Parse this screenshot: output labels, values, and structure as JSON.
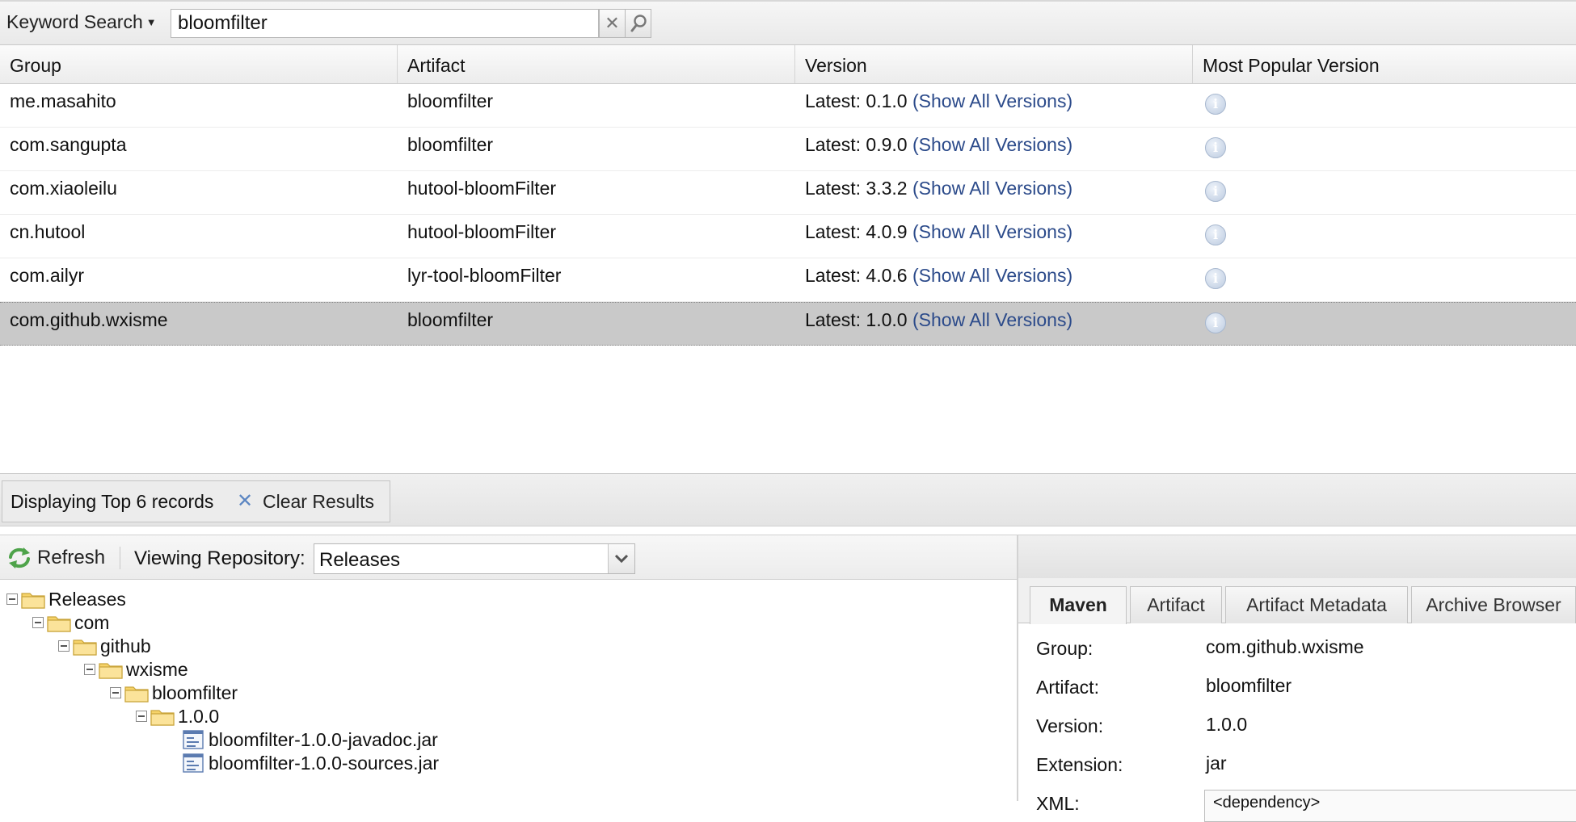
{
  "search": {
    "mode_label": "Keyword Search",
    "query": "bloomfilter"
  },
  "grid": {
    "columns": [
      "Group",
      "Artifact",
      "Version",
      "Most Popular Version"
    ],
    "rows": [
      {
        "group": "me.masahito",
        "artifact": "bloomfilter",
        "latest": "Latest: 0.1.0",
        "show_all": "(Show All Versions)"
      },
      {
        "group": "com.sangupta",
        "artifact": "bloomfilter",
        "latest": "Latest: 0.9.0",
        "show_all": "(Show All Versions)"
      },
      {
        "group": "com.xiaoleilu",
        "artifact": "hutool-bloomFilter",
        "latest": "Latest: 3.3.2",
        "show_all": "(Show All Versions)"
      },
      {
        "group": "cn.hutool",
        "artifact": "hutool-bloomFilter",
        "latest": "Latest: 4.0.9",
        "show_all": "(Show All Versions)"
      },
      {
        "group": "com.ailyr",
        "artifact": "lyr-tool-bloomFilter",
        "latest": "Latest: 4.0.6",
        "show_all": "(Show All Versions)"
      },
      {
        "group": "com.github.wxisme",
        "artifact": "bloomfilter",
        "latest": "Latest: 1.0.0",
        "show_all": "(Show All Versions)"
      }
    ],
    "selected_row_index": 5
  },
  "status": {
    "text": "Displaying Top 6 records",
    "clear_label": "Clear Results"
  },
  "repository": {
    "refresh_label": "Refresh",
    "viewing_label": "Viewing Repository:",
    "selected_repo": "Releases",
    "tree": [
      {
        "label": "Releases",
        "type": "folder",
        "depth": 0
      },
      {
        "label": "com",
        "type": "folder",
        "depth": 1
      },
      {
        "label": "github",
        "type": "folder",
        "depth": 2
      },
      {
        "label": "wxisme",
        "type": "folder",
        "depth": 3
      },
      {
        "label": "bloomfilter",
        "type": "folder",
        "depth": 4
      },
      {
        "label": "1.0.0",
        "type": "folder",
        "depth": 5
      },
      {
        "label": "bloomfilter-1.0.0-javadoc.jar",
        "type": "file",
        "depth": 6
      },
      {
        "label": "bloomfilter-1.0.0-sources.jar",
        "type": "file",
        "depth": 6
      }
    ]
  },
  "details": {
    "tabs": [
      "Maven",
      "Artifact",
      "Artifact Metadata",
      "Archive Browser"
    ],
    "active_tab": "Maven",
    "fields": [
      {
        "label": "Group:",
        "value": "com.github.wxisme"
      },
      {
        "label": "Artifact:",
        "value": "bloomfilter"
      },
      {
        "label": "Version:",
        "value": "1.0.0"
      },
      {
        "label": "Extension:",
        "value": "jar"
      },
      {
        "label": "XML:",
        "value": "<dependency>"
      }
    ]
  },
  "colors": {
    "link": "#2b4a8a",
    "selected_row": "#c9c9c9",
    "clear_x": "#5c86c2"
  }
}
